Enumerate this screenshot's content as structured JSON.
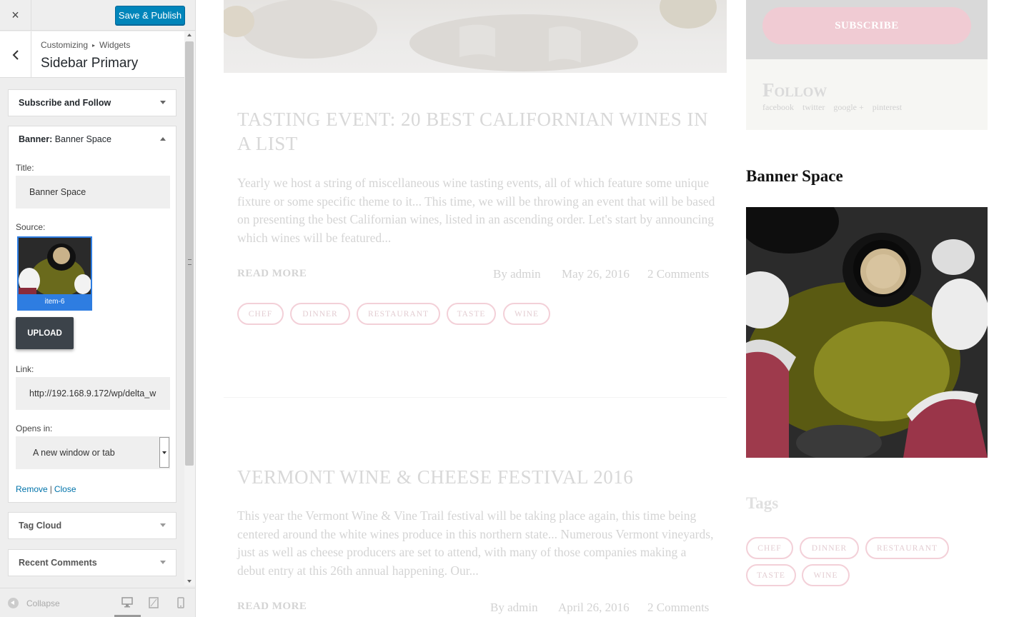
{
  "customizer": {
    "close_label": "×",
    "publish_label": "Save & Publish",
    "breadcrumb": {
      "root": "Customizing",
      "separator": "▸",
      "current": "Widgets"
    },
    "section_title": "Sidebar Primary",
    "widgets": [
      {
        "title": "Subscribe and Follow",
        "expanded": false
      },
      {
        "title": "Banner:",
        "subtitle": "Banner Space",
        "expanded": true
      },
      {
        "title": "Tag Cloud",
        "expanded": false
      },
      {
        "title": "Recent Comments",
        "expanded": false
      }
    ],
    "banner_form": {
      "title_label": "Title:",
      "title_value": "Banner Space",
      "source_label": "Source:",
      "source_item": "item-6",
      "upload_label": "UPLOAD",
      "link_label": "Link:",
      "link_value": "http://192.168.9.172/wp/delta_w",
      "opens_label": "Opens in:",
      "opens_value": "A new window or tab",
      "remove_label": "Remove",
      "close_label": "Close",
      "link_separator": "|"
    },
    "footer": {
      "collapse_label": "Collapse",
      "devices": [
        "desktop-icon",
        "tablet-icon",
        "mobile-icon"
      ],
      "active_device": "desktop"
    }
  },
  "preview": {
    "posts": [
      {
        "title": "TASTING EVENT: 20 BEST CALIFORNIAN WINES IN A LIST",
        "excerpt": "Yearly we host a string of miscellaneous wine tasting events, all of which feature some unique fixture or some specific theme to it... This time, we will be throwing an event that will be based on presenting the best Californian wines, listed in an ascending order. Let's start by announcing which wines will be featured...",
        "read_more": "READ MORE",
        "author": "By admin",
        "date": "May 26, 2016",
        "comments": "2 Comments",
        "tags": [
          "CHEF",
          "DINNER",
          "RESTAURANT",
          "TASTE",
          "WINE"
        ]
      },
      {
        "title": "VERMONT WINE & CHEESE FESTIVAL 2016",
        "excerpt": "This year the Vermont Wine & Vine Trail festival will be taking place again, this time being centered around the white wines produce in this northern state... Numerous Vermont vineyards, just as well as cheese producers are set to attend, with many of those companies making a debut entry at this 26th annual happening. Our...",
        "read_more": "READ MORE",
        "author": "By admin",
        "date": "April 26, 2016",
        "comments": "2 Comments"
      }
    ],
    "sidebar": {
      "subscribe_label": "SUBSCRIBE",
      "follow_title": "Follow",
      "follow_links": [
        "facebook",
        "twitter",
        "google +",
        "pinterest"
      ],
      "banner_title": "Banner Space",
      "tags_title": "Tags",
      "tags": [
        "CHEF",
        "DINNER",
        "RESTAURANT",
        "TASTE",
        "WINE"
      ]
    }
  },
  "colors": {
    "publish": "#0085ba",
    "link": "#0073aa",
    "thumb_select": "#2e7de1",
    "tag_border": "#f3d0d8",
    "subscribe_btn": "#f0cbd3"
  }
}
